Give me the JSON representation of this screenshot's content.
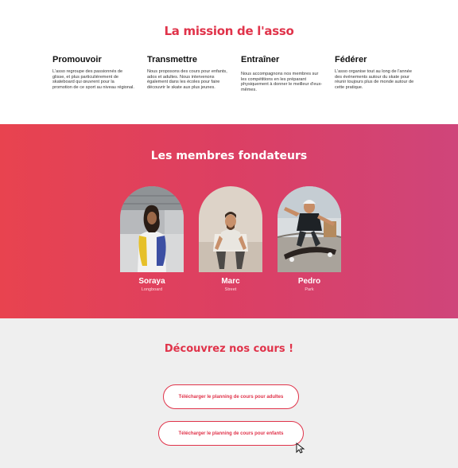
{
  "mission": {
    "title": "La mission de l'asso",
    "columns": [
      {
        "heading": "Promouvoir",
        "text": "L'asso regroupe des passionnés de glisse, et plus particulièrement de skateboard qui œuvrent pour la promotion de ce sport au niveau régional."
      },
      {
        "heading": "Transmettre",
        "text": "Nous proposons des cours pour enfants, ados et adultes. Nous intervenons également dans les écoles pour faire découvrir le skate aux plus jeunes."
      },
      {
        "heading": "Entraîner",
        "text": "Nous accompagnons nos membres sur les compétitions en les préparant physiquement à donner le meilleur d'eux-mêmes."
      },
      {
        "heading": "Fédérer",
        "text": "L'asso organise tout au long de l'année des événements autour du skate pour réunir toujours plus de monde autour de cette pratique."
      }
    ]
  },
  "founders": {
    "title": "Les membres fondateurs",
    "members": [
      {
        "name": "Soraya",
        "role": "Longboard"
      },
      {
        "name": "Marc",
        "role": "Street"
      },
      {
        "name": "Pedro",
        "role": "Park"
      }
    ]
  },
  "courses": {
    "title": "Découvrez nos cours !",
    "adults_button": "Télécharger le planning de cours pour adultes",
    "kids_button": "Télécharger le planning de cours pour enfants"
  },
  "colors": {
    "accent": "#e0334a",
    "gradient_start": "#e8434f",
    "gradient_end": "#cf457a",
    "courses_bg": "#efefef"
  },
  "icons": {
    "cursor": "mouse-pointer-icon"
  }
}
